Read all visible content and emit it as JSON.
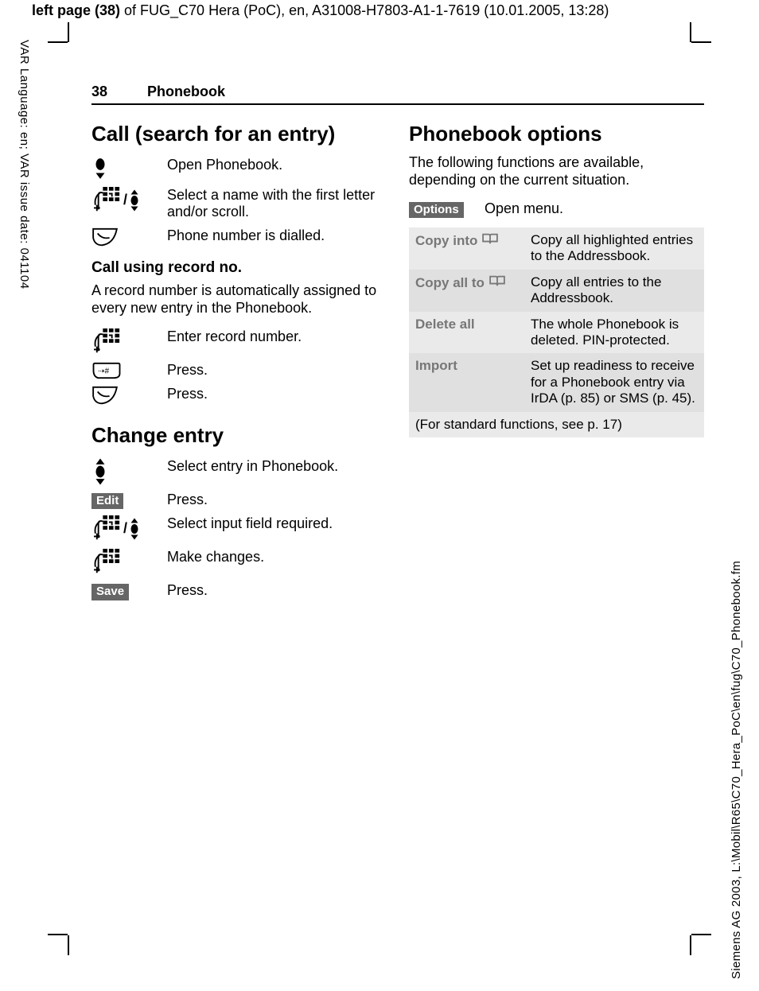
{
  "meta": {
    "top_bold": "left page (38)",
    "top_rest": " of FUG_C70 Hera (PoC), en, A31008-H7803-A1-1-7619 (10.01.2005, 13:28)",
    "left_side": "VAR Language: en; VAR issue date: 041104",
    "right_side": "Siemens AG 2003, L:\\Mobil\\R65\\C70_Hera_PoC\\en\\fug\\C70_Phonebook.fm"
  },
  "header": {
    "page_num": "38",
    "title": "Phonebook"
  },
  "left": {
    "h_call": "Call (search for an entry)",
    "call_steps": [
      {
        "icon": "joy-down",
        "text": "Open Phonebook."
      },
      {
        "icon": "keypad-joy",
        "text": "Select a name with the first letter and/or scroll."
      },
      {
        "icon": "call-key",
        "text": "Phone number is dialled."
      }
    ],
    "h_record": "Call using record no.",
    "record_p": "A record number is automatically assigned to every new entry in the Phonebook.",
    "record_steps": [
      {
        "icon": "keypad",
        "text": "Enter record number."
      },
      {
        "icon": "hash-key",
        "text": "Press."
      },
      {
        "icon": "call-key",
        "text": "Press."
      }
    ],
    "h_change": "Change entry",
    "change_steps": [
      {
        "icon": "joy-updown",
        "text": "Select entry in Phonebook."
      },
      {
        "icon": "softkey",
        "label": "Edit",
        "text": "Press."
      },
      {
        "icon": "keypad-joy",
        "text": "Select input field required."
      },
      {
        "icon": "keypad",
        "text": "Make changes."
      },
      {
        "icon": "softkey",
        "label": "Save",
        "text": "Press."
      }
    ]
  },
  "right": {
    "h_options": "Phonebook options",
    "intro": "The following functions are available, depending on the current situation.",
    "options_key": "Options",
    "options_text": "Open menu.",
    "rows": [
      {
        "label": "Copy into",
        "has_book": true,
        "desc": "Copy all highlighted entries to the Addressbook."
      },
      {
        "label": "Copy all to",
        "has_book": true,
        "desc": "Copy all entries to the Addressbook."
      },
      {
        "label": "Delete all",
        "has_book": false,
        "desc": "The whole Phonebook is deleted. PIN-protected."
      },
      {
        "label": "Import",
        "has_book": false,
        "desc": "Set up readiness to receive for a Phonebook entry via IrDA (p. 85) or SMS (p. 45)."
      }
    ],
    "footer": "(For standard functions, see p. 17)"
  }
}
